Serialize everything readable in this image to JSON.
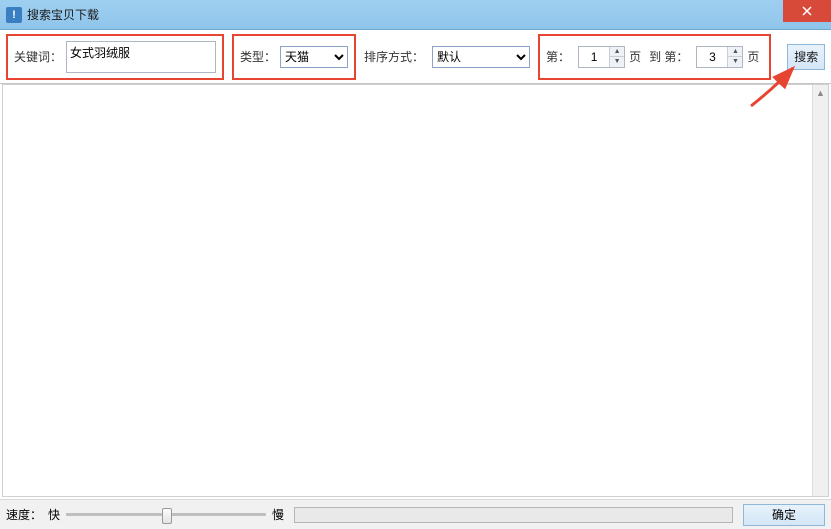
{
  "window": {
    "title": "搜索宝贝下载"
  },
  "toolbar": {
    "keyword_label": "关键词：",
    "keyword_value": "女式羽绒服",
    "type_label": "类型：",
    "type_value": "天猫",
    "sort_label": "排序方式：",
    "sort_value": "默认",
    "page_prefix": "第：",
    "page_from": "1",
    "page_mid1": "页",
    "page_to_label": "到 第：",
    "page_to": "3",
    "page_mid2": "页",
    "search_label": "搜索"
  },
  "footer": {
    "speed_label": "速度：",
    "fast_label": "快",
    "slow_label": "慢",
    "ok_label": "确定"
  }
}
